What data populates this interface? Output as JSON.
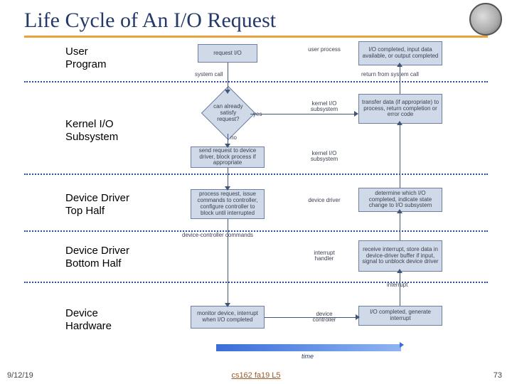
{
  "title": "Life Cycle of An I/O Request",
  "footer": {
    "date": "9/12/19",
    "center": "cs162 fa19 L5",
    "page": "73"
  },
  "rows": {
    "r1": "User\nProgram",
    "r2": "Kernel I/O\nSubsystem",
    "r3": "Device Driver\nTop Half",
    "r4": "Device Driver\nBottom Half",
    "r5": "Device\nHardware"
  },
  "left": {
    "n1": "request I/O",
    "d1": "can already satisfy request?",
    "n2": "send request to device driver, block process if appropriate",
    "n3": "process request, issue commands to controller, configure controller to block until interrupted",
    "n4": "monitor device, interrupt when I/O completed",
    "yes": "yes",
    "no": "no",
    "sc": "system call",
    "dcc": "device-controller commands"
  },
  "side": {
    "s1": "user process",
    "s2": "kernel I/O subsystem",
    "s3": "kernel I/O subsystem",
    "s4": "device driver",
    "s5": "interrupt handler",
    "s6": "device controller"
  },
  "right": {
    "n1": "I/O completed, input data available, or output completed",
    "n2": "transfer data (if appropriate) to process, return completion or error code",
    "n3": "determine which I/O completed, indicate state change to I/O subsystem",
    "n4": "receive interrupt, store data in device-driver buffer if input, signal to unblock device driver",
    "n5": "I/O completed, generate interrupt",
    "ret": "return from system call",
    "intr": "interrupt"
  },
  "time": "time"
}
